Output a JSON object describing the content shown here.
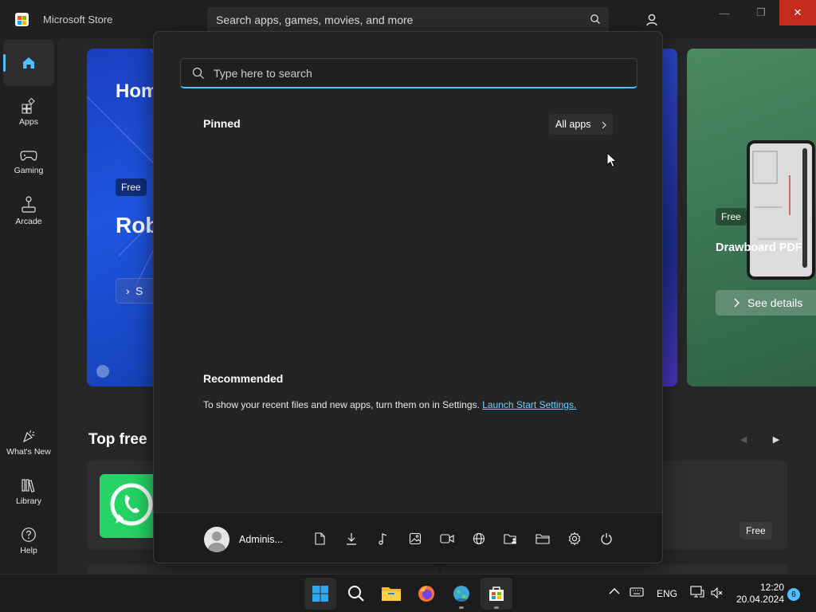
{
  "window": {
    "title": "Microsoft Store",
    "search_placeholder": "Search apps, games, movies, and more",
    "controls": {
      "minimize": "—",
      "maximize": "❐",
      "close": "✕"
    }
  },
  "nav": {
    "top": [
      {
        "label": "",
        "icon": "home-icon",
        "active": true
      },
      {
        "label": "Apps",
        "icon": "apps-icon"
      },
      {
        "label": "Gaming",
        "icon": "gamepad-icon"
      },
      {
        "label": "Arcade",
        "icon": "joystick-icon"
      }
    ],
    "bottom": [
      {
        "label": "What's New",
        "icon": "party-icon"
      },
      {
        "label": "Library",
        "icon": "library-icon"
      },
      {
        "label": "Help",
        "icon": "help-icon"
      }
    ]
  },
  "hero": {
    "left": {
      "title": "Hom",
      "badge": "Free",
      "game": "Rob",
      "button": "S"
    },
    "right": {
      "badge": "Free",
      "name": "Drawboard PDF",
      "button": "See details"
    }
  },
  "top_free": {
    "title": "Top free",
    "card_badge": "Free"
  },
  "start_menu": {
    "search_placeholder": "Type here to search",
    "pinned_label": "Pinned",
    "all_apps_label": "All apps",
    "recommended_label": "Recommended",
    "recommended_text": "To show your recent files and new apps, turn them on in Settings.",
    "recommended_link": "Launch Start Settings.",
    "user_name": "Adminis...",
    "footer_buttons": [
      "documents-icon",
      "downloads-icon",
      "music-icon",
      "pictures-icon",
      "videos-icon",
      "network-icon",
      "personal-folder-icon",
      "file-explorer-icon",
      "settings-icon",
      "power-icon"
    ]
  },
  "taskbar": {
    "apps": [
      "start-icon",
      "search-icon",
      "file-explorer-icon",
      "firefox-icon",
      "network-globe-icon",
      "microsoft-store-icon"
    ],
    "language": "ENG",
    "time": "12:20",
    "date": "20.04.2024",
    "notification_count": "6"
  },
  "colors": {
    "accent": "#4cc2ff",
    "close": "#c42b1c",
    "hero_blue": "#1f55e0",
    "hero_green": "#3b7653",
    "whatsapp": "#25d366"
  }
}
